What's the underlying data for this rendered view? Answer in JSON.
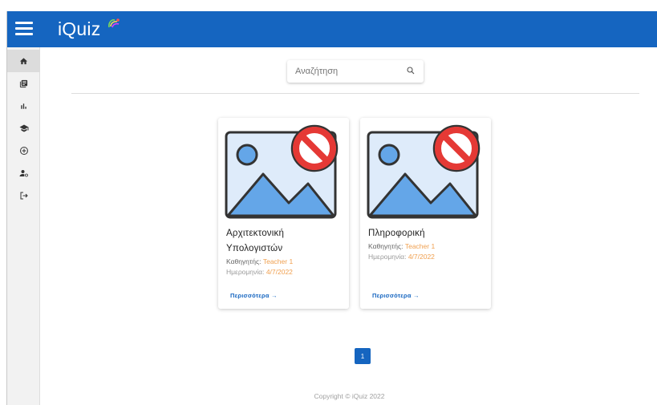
{
  "app": {
    "name": "iQuiz",
    "brand_color": "#1565c0",
    "accent_color": "#f0a050"
  },
  "sidebar": {
    "items": [
      {
        "name": "home",
        "icon": "home-icon"
      },
      {
        "name": "courses",
        "icon": "library-books-icon"
      },
      {
        "name": "statistics",
        "icon": "bar-chart-icon"
      },
      {
        "name": "school",
        "icon": "school-icon"
      },
      {
        "name": "add",
        "icon": "add-circle-icon"
      },
      {
        "name": "admin",
        "icon": "manage-accounts-icon"
      },
      {
        "name": "logout",
        "icon": "logout-icon"
      }
    ]
  },
  "search": {
    "placeholder": "Αναζήτηση"
  },
  "courses": [
    {
      "title": "Αρχιτεκτονική Υπολογιστών",
      "teacher_label": "Καθηγητής:",
      "teacher": "Teacher 1",
      "date_label": "Ημερομηνία:",
      "date": "4/7/2022",
      "more_label": "Περισσότερα →"
    },
    {
      "title": "Πληροφορική",
      "teacher_label": "Καθηγητής:",
      "teacher": "Teacher 1",
      "date_label": "Ημερομηνία:",
      "date": "4/7/2022",
      "more_label": "Περισσότερα →"
    }
  ],
  "pagination": {
    "current_page": "1"
  },
  "footer": {
    "copyright": "Copyright © iQuiz 2022"
  }
}
